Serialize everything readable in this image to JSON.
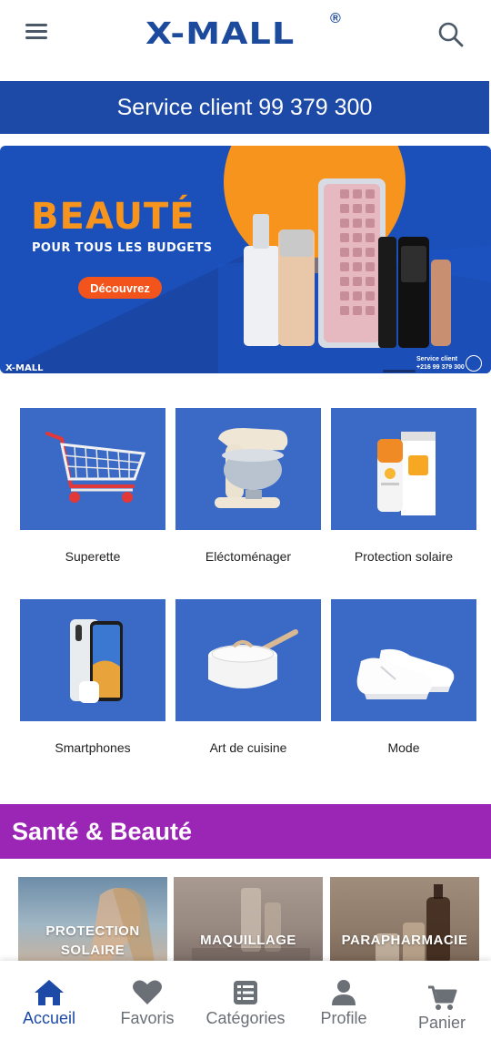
{
  "header": {
    "logo_text": "X-MALL",
    "logo_mark": "®",
    "menu_icon": "hamburger-menu-icon",
    "search_icon": "search-icon"
  },
  "service_band": {
    "text": "Service client 99 379 300"
  },
  "hero": {
    "title": "BEAUTÉ",
    "subtitle": "POUR TOUS LES BUDGETS",
    "cta": "Découvrez",
    "brand": "X-MALL",
    "contact_line1": "Service client",
    "contact_line2": "+216 99 379 300",
    "phone_icon": "phone-icon"
  },
  "categories": [
    {
      "label": "Superette",
      "icon": "shopping-cart-icon"
    },
    {
      "label": "Eléctoménager",
      "icon": "stand-mixer-icon"
    },
    {
      "label": "Protection solaire",
      "icon": "sunscreen-icon"
    },
    {
      "label": "Smartphones",
      "icon": "smartphone-icon"
    },
    {
      "label": "Art de cuisine",
      "icon": "saute-pan-icon"
    },
    {
      "label": "Mode",
      "icon": "sneakers-icon"
    }
  ],
  "section": {
    "title": "Santé & Beauté"
  },
  "subcategories": [
    {
      "label_line1": "PROTECTION",
      "label_line2": "SOLAIRE"
    },
    {
      "label_line1": "MAQUILLAGE",
      "label_line2": ""
    },
    {
      "label_line1": "PARAPHARMACIE",
      "label_line2": ""
    }
  ],
  "bottom_nav": [
    {
      "label": "Accueil",
      "icon": "home-icon",
      "active": true
    },
    {
      "label": "Favoris",
      "icon": "heart-icon",
      "active": false
    },
    {
      "label": "Catégories",
      "icon": "list-icon",
      "active": false
    },
    {
      "label": "Profile",
      "icon": "user-icon",
      "active": false
    },
    {
      "label": "Panier",
      "icon": "cart-icon",
      "active": false
    }
  ],
  "colors": {
    "brand_blue": "#1c4aa6",
    "tile_blue": "#3b6ac6",
    "section_purple": "#9b26b6",
    "hero_orange": "#f7941d",
    "cta_orange": "#f2541b"
  }
}
